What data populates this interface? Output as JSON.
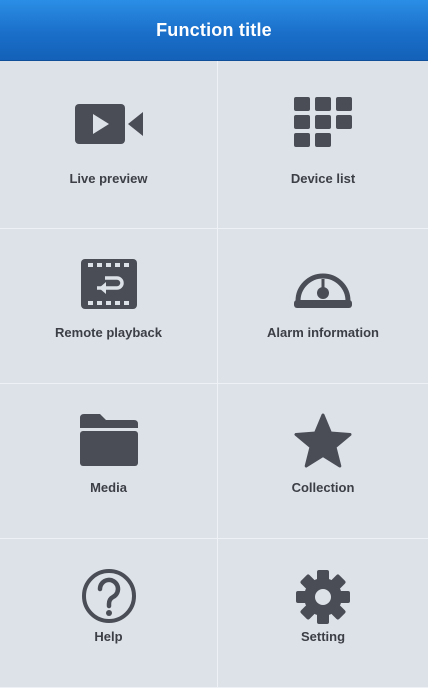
{
  "header": {
    "title": "Function title"
  },
  "menu": [
    {
      "label": "Live preview",
      "icon": "video-camera-icon"
    },
    {
      "label": "Device list",
      "icon": "grid-icon"
    },
    {
      "label": "Remote playback",
      "icon": "film-replay-icon"
    },
    {
      "label": "Alarm information",
      "icon": "dome-camera-icon"
    },
    {
      "label": "Media",
      "icon": "folder-icon"
    },
    {
      "label": "Collection",
      "icon": "star-icon"
    },
    {
      "label": "Help",
      "icon": "help-icon"
    },
    {
      "label": "Setting",
      "icon": "gear-icon"
    }
  ],
  "colors": {
    "titlebar": "#1a6fc9",
    "background": "#dde1e8",
    "icon": "#4a4d55",
    "label": "#3c3f45"
  }
}
